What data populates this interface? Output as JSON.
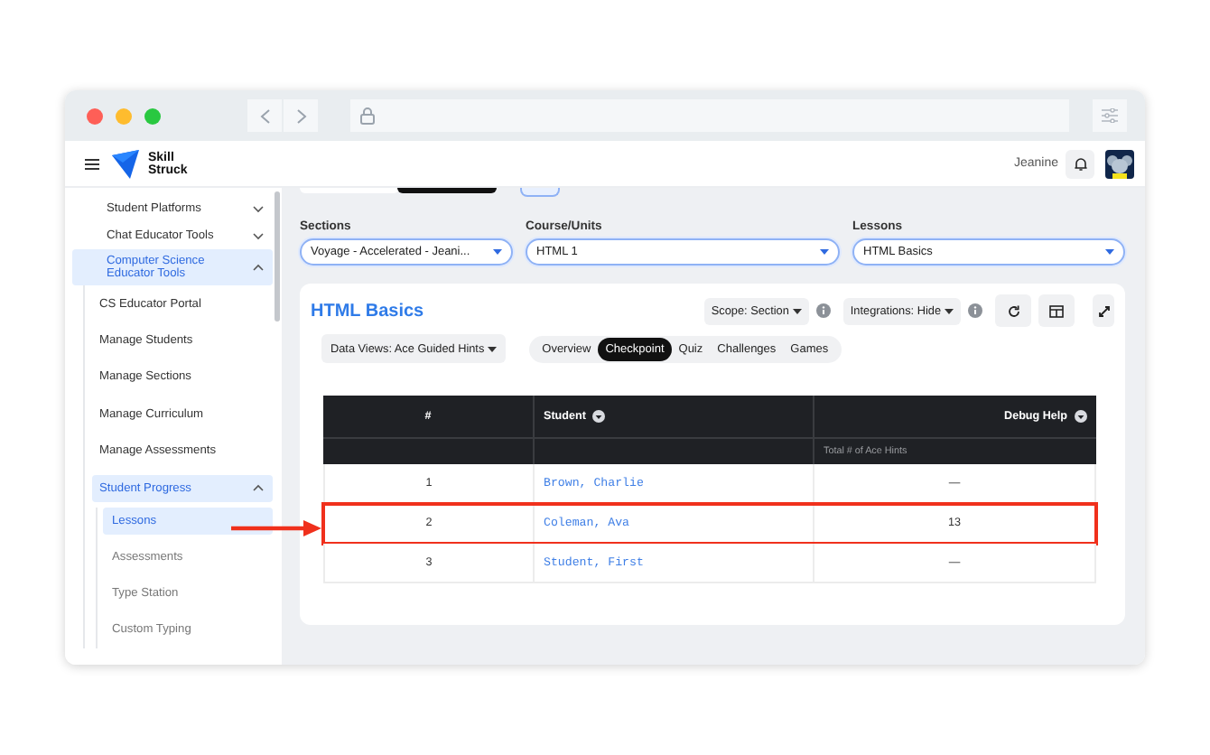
{
  "app_header": {
    "brand": "Skill Struck",
    "user_name": "Jeanine"
  },
  "sidebar": {
    "items": [
      {
        "label": "Student Platforms",
        "expanded": false,
        "selected": false
      },
      {
        "label": "Chat Educator Tools",
        "expanded": false,
        "selected": false
      },
      {
        "label": "Computer Science Educator Tools",
        "expanded": true,
        "selected": true,
        "children": [
          {
            "label": "CS Educator Portal",
            "selected": false
          },
          {
            "label": "Manage Students",
            "selected": false
          },
          {
            "label": "Manage Sections",
            "selected": false
          },
          {
            "label": "Manage Curriculum",
            "selected": false
          },
          {
            "label": "Manage Assessments",
            "selected": false
          },
          {
            "label": "Student Progress",
            "expanded": true,
            "selected": true,
            "children": [
              {
                "label": "Lessons",
                "selected": true
              },
              {
                "label": "Assessments",
                "selected": false
              },
              {
                "label": "Type Station",
                "selected": false
              },
              {
                "label": "Custom Typing",
                "selected": false
              }
            ]
          }
        ]
      }
    ]
  },
  "filters": [
    {
      "label": "Sections",
      "value": "Voyage - Accelerated - Jeani..."
    },
    {
      "label": "Course/Units",
      "value": "HTML 1"
    },
    {
      "label": "Lessons",
      "value": "HTML Basics"
    }
  ],
  "card": {
    "title": "HTML Basics",
    "scope_button": "Scope: Section",
    "integrations_button": "Integrations: Hide",
    "data_views_button": "Data Views: Ace Guided Hints",
    "view_tabs": [
      {
        "label": "Overview",
        "selected": false
      },
      {
        "label": "Checkpoint",
        "selected": true
      },
      {
        "label": "Quiz",
        "selected": false
      },
      {
        "label": "Challenges",
        "selected": false
      },
      {
        "label": "Games",
        "selected": false
      }
    ],
    "table": {
      "columns": [
        "#",
        "Student",
        "Debug Help"
      ],
      "subheader": "Total # of Ace Hints",
      "rows": [
        {
          "number": "1",
          "student": "Brown, Charlie",
          "hints": "—",
          "highlighted": false
        },
        {
          "number": "2",
          "student": "Coleman, Ava",
          "hints": "13",
          "highlighted": true
        },
        {
          "number": "3",
          "student": "Student, First",
          "hints": "—",
          "highlighted": false
        }
      ]
    }
  }
}
